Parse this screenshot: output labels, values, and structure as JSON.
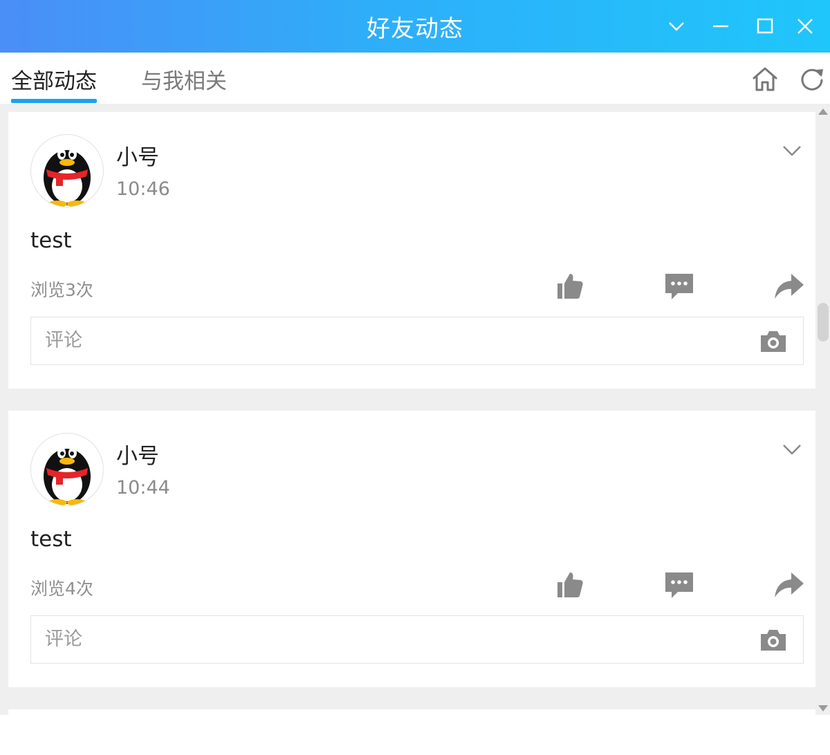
{
  "window": {
    "title": "好友动态",
    "controls": [
      "chevron-down-icon",
      "minimize-icon",
      "maximize-icon",
      "close-icon"
    ],
    "gradient": [
      "#4a8ef7",
      "#1fc6fb"
    ]
  },
  "tabs": [
    {
      "label": "全部动态",
      "active": true
    },
    {
      "label": "与我相关",
      "active": false
    }
  ],
  "toolbar": {
    "icons": [
      "home-icon",
      "refresh-icon"
    ]
  },
  "accent": "#1aa1f0",
  "posts": [
    {
      "user": "小号",
      "time": "10:46",
      "content": "test",
      "views": "浏览3次",
      "comment_placeholder": "评论",
      "actions": [
        "like-icon",
        "comment-icon",
        "share-icon"
      ]
    },
    {
      "user": "小号",
      "time": "10:44",
      "content": "test",
      "views": "浏览4次",
      "comment_placeholder": "评论",
      "actions": [
        "like-icon",
        "comment-icon",
        "share-icon"
      ]
    }
  ]
}
